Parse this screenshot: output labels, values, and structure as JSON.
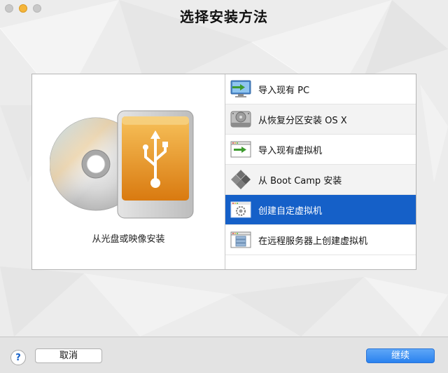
{
  "window": {
    "title": "选择安装方法"
  },
  "left_pane": {
    "caption": "从光盘或映像安装",
    "icon": "disc-and-usb-drive-icon"
  },
  "install_methods": [
    {
      "label": "导入现有 PC",
      "icon": "monitor-import-icon",
      "selected": false
    },
    {
      "label": "从恢复分区安装 OS X",
      "icon": "hard-drive-icon",
      "selected": false
    },
    {
      "label": "导入现有虚拟机",
      "icon": "window-import-icon",
      "selected": false
    },
    {
      "label": "从 Boot Camp 安装",
      "icon": "boot-camp-icon",
      "selected": false
    },
    {
      "label": "创建自定虚拟机",
      "icon": "custom-vm-icon",
      "selected": true
    },
    {
      "label": "在远程服务器上创建虚拟机",
      "icon": "remote-server-icon",
      "selected": false
    }
  ],
  "footer": {
    "help_label": "?",
    "cancel_label": "取消",
    "continue_label": "继续"
  },
  "colors": {
    "selection": "#1560c8",
    "accent_button": "#2a82ef",
    "usb_orange": "#e89a1c"
  }
}
